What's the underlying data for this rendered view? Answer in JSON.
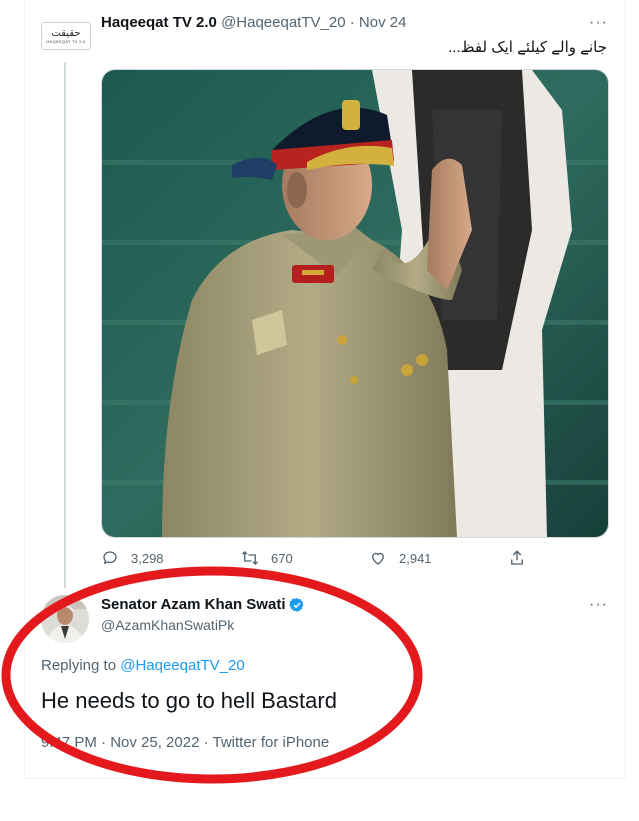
{
  "tweet1": {
    "display_name": "Haqeeqat TV 2.0",
    "handle": "@HaqeeqatTV_20",
    "separator": "·",
    "date": "Nov 24",
    "text": "جانے والے کیلئے ایک لفظ...",
    "avatar_text": "حقیقت",
    "avatar_sub": "HAQEEQAT TV 2.0",
    "more_icon": "···",
    "actions": {
      "replies": "3,298",
      "retweets": "670",
      "likes": "2,941"
    }
  },
  "tweet2": {
    "display_name": "Senator Azam Khan Swati",
    "handle": "@AzamKhanSwatiPk",
    "more_icon": "···",
    "replying_prefix": "Replying to",
    "replying_handle": "@HaqeeqatTV_20",
    "text": "He needs to go to hell Bastard",
    "meta": "9:47 PM · Nov 25, 2022 · Twitter for iPhone"
  },
  "colors": {
    "link": "#1d9bf0",
    "muted": "#536471",
    "annotation": "#e3191d"
  }
}
